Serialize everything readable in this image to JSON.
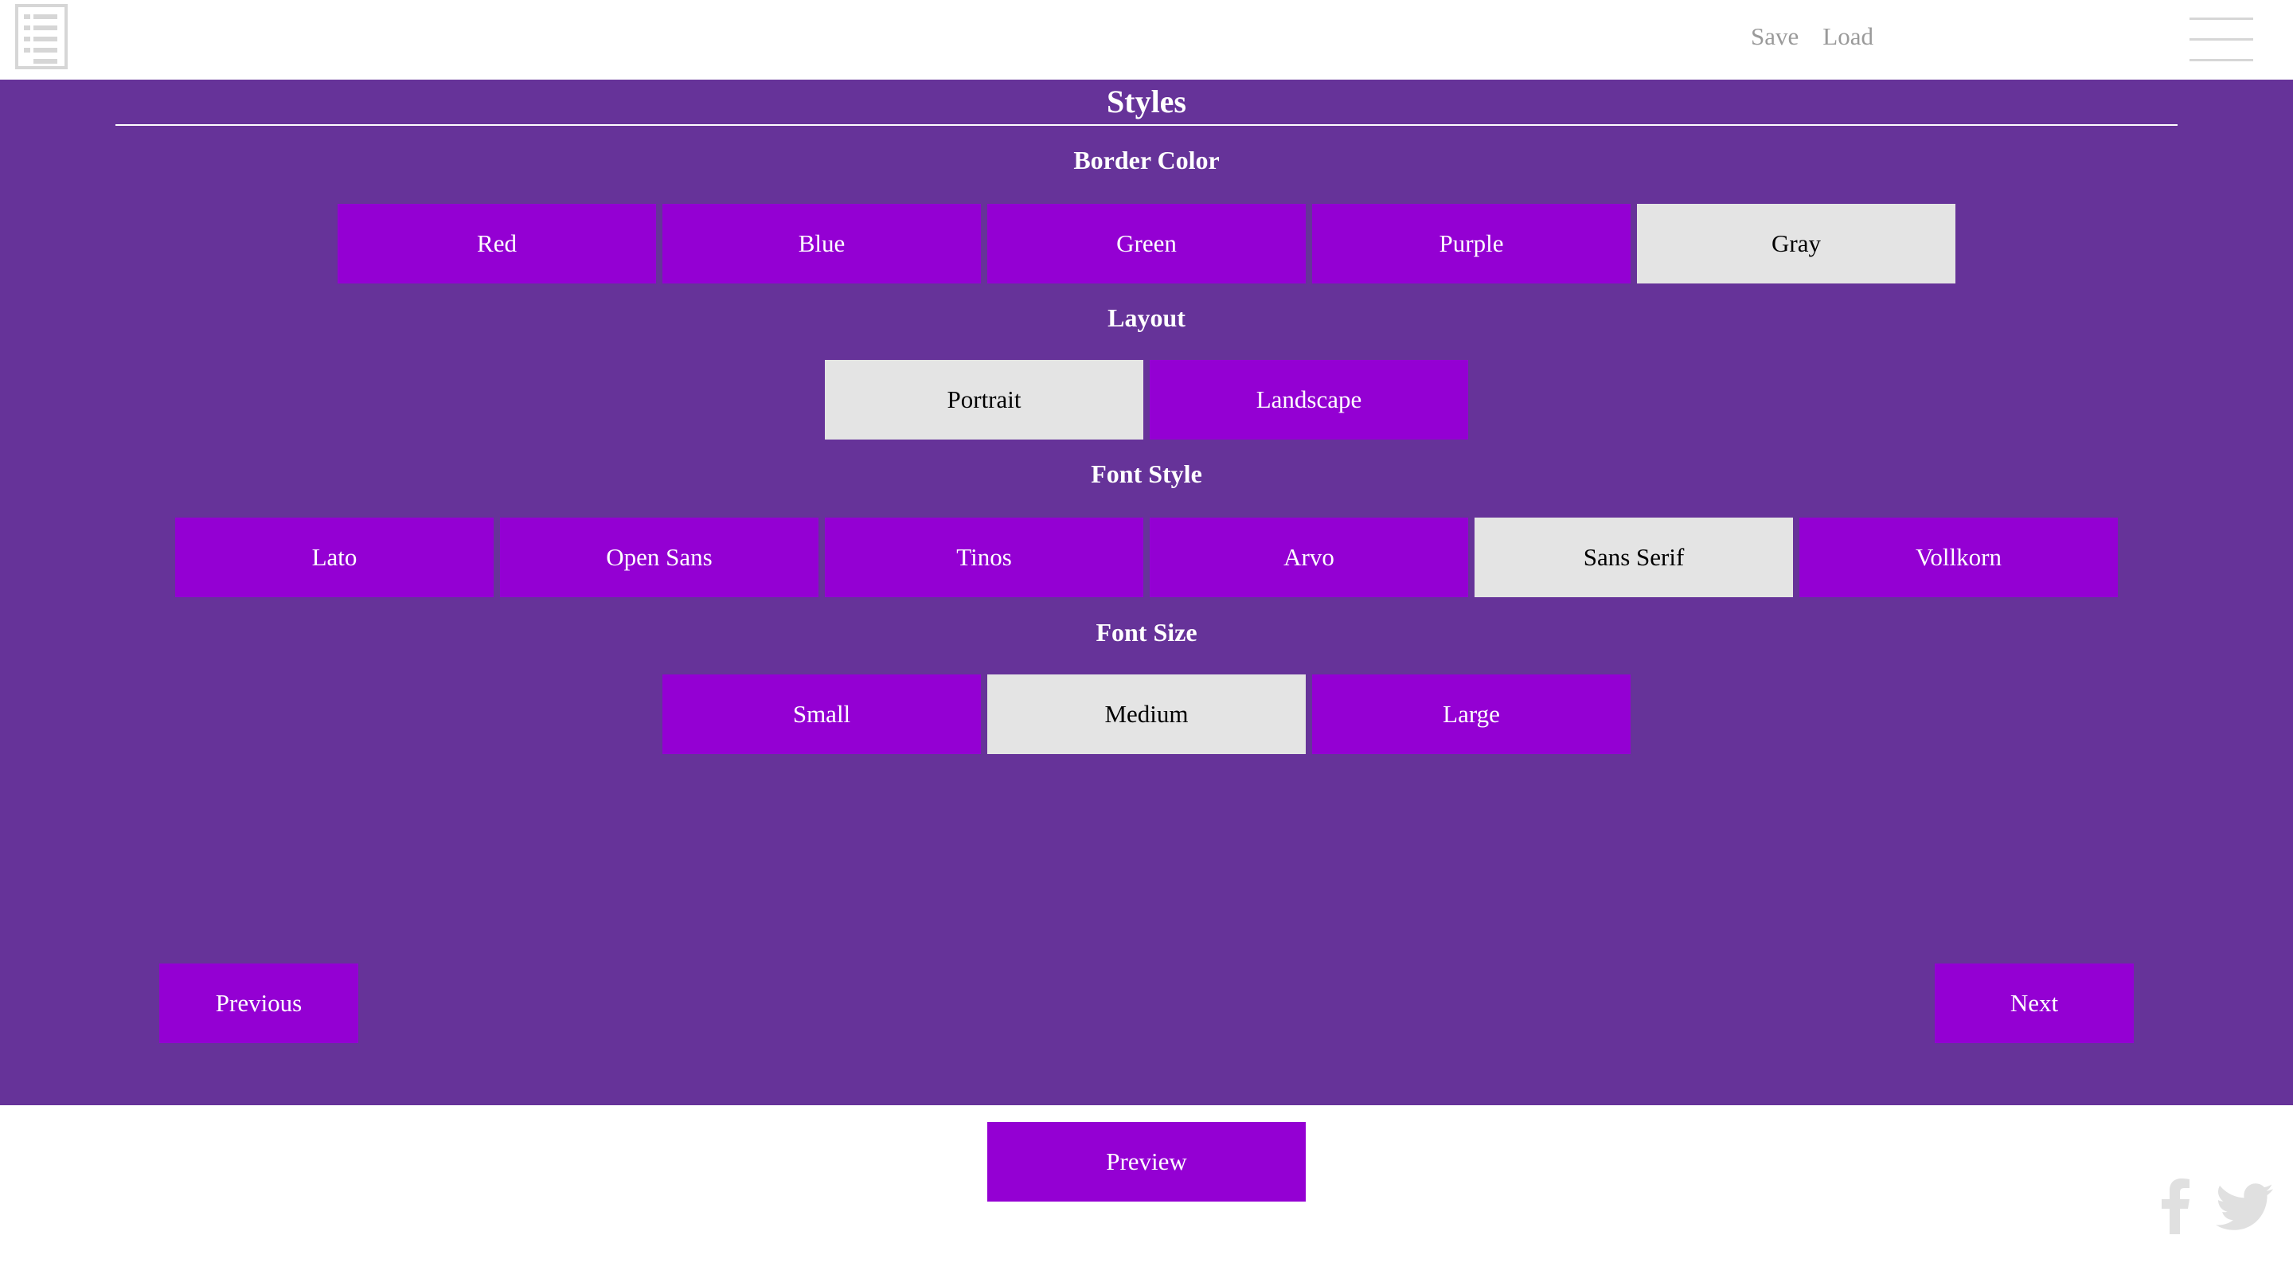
{
  "header": {
    "logo_icon": "document-list-icon",
    "links": [
      "Save",
      "Load"
    ],
    "menu_icon": "hamburger-menu-icon"
  },
  "main": {
    "title": "Styles",
    "groups": [
      {
        "label": "Border Color",
        "options": [
          "Red",
          "Blue",
          "Green",
          "Purple",
          "Gray"
        ],
        "selected": "Gray"
      },
      {
        "label": "Layout",
        "options": [
          "Portrait",
          "Landscape"
        ],
        "selected": "Portrait"
      },
      {
        "label": "Font Style",
        "options": [
          "Lato",
          "Open Sans",
          "Tinos",
          "Arvo",
          "Sans Serif",
          "Vollkorn"
        ],
        "selected": "Sans Serif"
      },
      {
        "label": "Font Size",
        "options": [
          "Small",
          "Medium",
          "Large"
        ],
        "selected": "Medium"
      }
    ],
    "previous_label": "Previous",
    "next_label": "Next"
  },
  "footer": {
    "preview_label": "Preview",
    "social_icons": [
      "facebook-icon",
      "twitter-icon"
    ]
  },
  "colors": {
    "panel_background": "#663399",
    "button_background": "#9400d3",
    "selected_background": "#e4e4e4",
    "header_link": "#9a9a9a",
    "icon_gray": "#d6d6d6"
  }
}
